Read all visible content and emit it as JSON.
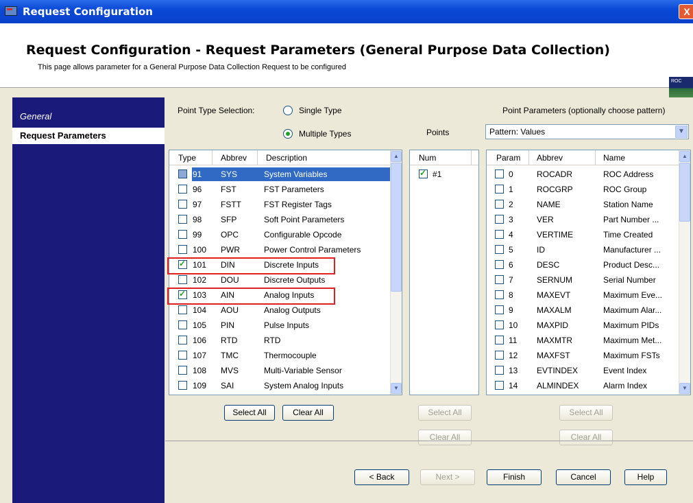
{
  "window": {
    "title": "Request Configuration",
    "close": "X"
  },
  "header": {
    "title": "Request Configuration - Request Parameters (General Purpose Data Collection)",
    "subtitle": "This page allows parameter for a General Purpose Data Collection Request to be configured",
    "logo_text": "ROC"
  },
  "sidebar": {
    "items": [
      {
        "label": "General"
      },
      {
        "label": "Request Parameters"
      }
    ]
  },
  "point_type": {
    "label": "Point Type Selection:",
    "options": [
      {
        "label": "Single Type",
        "selected": false
      },
      {
        "label": "Multiple Types",
        "selected": true
      }
    ],
    "columns": [
      "Type",
      "Abbrev",
      "Description"
    ],
    "rows": [
      {
        "type": "91",
        "abbrev": "SYS",
        "desc": "System Variables",
        "checked": false,
        "selected": true
      },
      {
        "type": "96",
        "abbrev": "FST",
        "desc": "FST Parameters",
        "checked": false
      },
      {
        "type": "97",
        "abbrev": "FSTT",
        "desc": "FST Register Tags",
        "checked": false
      },
      {
        "type": "98",
        "abbrev": "SFP",
        "desc": "Soft Point Parameters",
        "checked": false
      },
      {
        "type": "99",
        "abbrev": "OPC",
        "desc": "Configurable Opcode",
        "checked": false
      },
      {
        "type": "100",
        "abbrev": "PWR",
        "desc": "Power Control Parameters",
        "checked": false
      },
      {
        "type": "101",
        "abbrev": "DIN",
        "desc": "Discrete Inputs",
        "checked": true
      },
      {
        "type": "102",
        "abbrev": "DOU",
        "desc": "Discrete Outputs",
        "checked": false
      },
      {
        "type": "103",
        "abbrev": "AIN",
        "desc": "Analog Inputs",
        "checked": true
      },
      {
        "type": "104",
        "abbrev": "AOU",
        "desc": "Analog Outputs",
        "checked": false
      },
      {
        "type": "105",
        "abbrev": "PIN",
        "desc": "Pulse Inputs",
        "checked": false
      },
      {
        "type": "106",
        "abbrev": "RTD",
        "desc": "RTD",
        "checked": false
      },
      {
        "type": "107",
        "abbrev": "TMC",
        "desc": "Thermocouple",
        "checked": false
      },
      {
        "type": "108",
        "abbrev": "MVS",
        "desc": "Multi-Variable Sensor",
        "checked": false
      },
      {
        "type": "109",
        "abbrev": "SAI",
        "desc": "System Analog Inputs",
        "checked": false
      }
    ],
    "select_all": "Select All",
    "clear_all": "Clear All"
  },
  "points": {
    "label": "Points",
    "column": "Num",
    "rows": [
      {
        "num": "#1",
        "checked": true
      }
    ],
    "select_all": "Select All",
    "clear_all": "Clear All"
  },
  "params": {
    "label": "Point Parameters (optionally choose pattern)",
    "pattern": "Pattern: Values",
    "columns": [
      "Param",
      "Abbrev",
      "Name"
    ],
    "rows": [
      {
        "param": "0",
        "abbrev": "ROCADR",
        "name": "ROC Address"
      },
      {
        "param": "1",
        "abbrev": "ROCGRP",
        "name": "ROC Group"
      },
      {
        "param": "2",
        "abbrev": "NAME",
        "name": "Station Name"
      },
      {
        "param": "3",
        "abbrev": "VER",
        "name": "Part Number ..."
      },
      {
        "param": "4",
        "abbrev": "VERTIME",
        "name": "Time Created"
      },
      {
        "param": "5",
        "abbrev": "ID",
        "name": "Manufacturer ..."
      },
      {
        "param": "6",
        "abbrev": "DESC",
        "name": "Product Desc..."
      },
      {
        "param": "7",
        "abbrev": "SERNUM",
        "name": "Serial Number"
      },
      {
        "param": "8",
        "abbrev": "MAXEVT",
        "name": "Maximum Eve..."
      },
      {
        "param": "9",
        "abbrev": "MAXALM",
        "name": "Maximum Alar..."
      },
      {
        "param": "10",
        "abbrev": "MAXPID",
        "name": "Maximum PIDs"
      },
      {
        "param": "11",
        "abbrev": "MAXMTR",
        "name": "Maximum Met..."
      },
      {
        "param": "12",
        "abbrev": "MAXFST",
        "name": "Maximum FSTs"
      },
      {
        "param": "13",
        "abbrev": "EVTINDEX",
        "name": "Event Index"
      },
      {
        "param": "14",
        "abbrev": "ALMINDEX",
        "name": "Alarm Index"
      }
    ],
    "select_all": "Select All",
    "clear_all": "Clear All"
  },
  "footer": {
    "back": "< Back",
    "next": "Next >",
    "finish": "Finish",
    "cancel": "Cancel",
    "help": "Help"
  },
  "colors": {
    "sidebar": "#1a1a7a",
    "titlebar": "#0a49d6",
    "highlight": "#316ac5",
    "callout": "#e02020"
  }
}
